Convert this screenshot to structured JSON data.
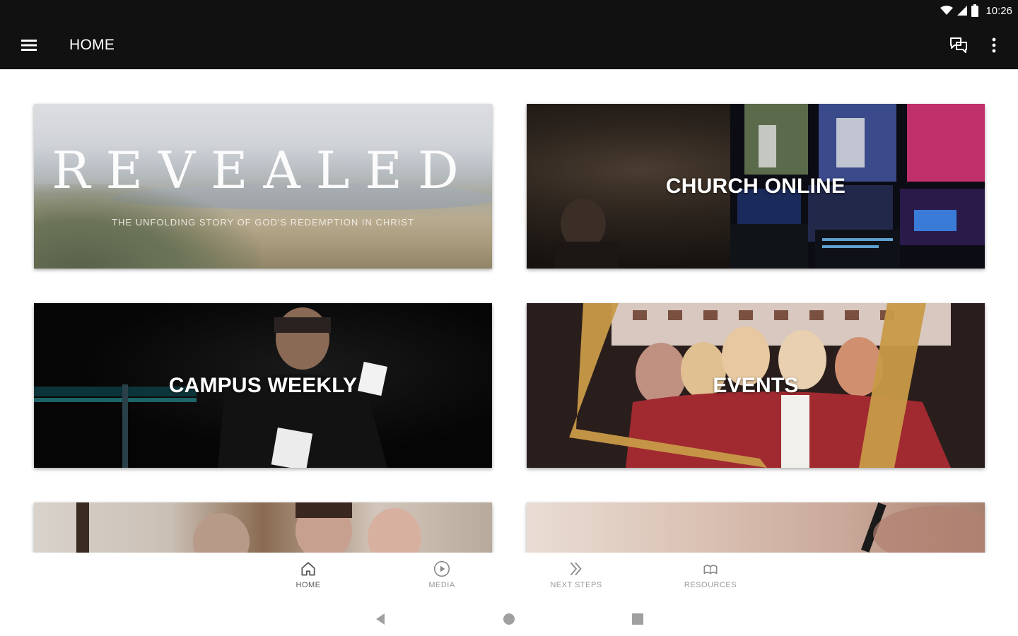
{
  "status_bar": {
    "time": "10:26"
  },
  "app_bar": {
    "title": "HOME",
    "menu_icon": "hamburger-menu-icon",
    "chat_icon": "chat-bubbles-icon",
    "more_icon": "more-vert-icon"
  },
  "cards": [
    {
      "id": "revealed",
      "title": "REVEALED",
      "subtitle": "THE UNFOLDING STORY OF GOD'S REDEMPTION IN CHRIST"
    },
    {
      "id": "church-online",
      "title": "CHURCH ONLINE"
    },
    {
      "id": "campus-weekly",
      "title": "CAMPUS WEEKLY"
    },
    {
      "id": "events",
      "title": "EVENTS"
    },
    {
      "id": "row3-left",
      "title": ""
    },
    {
      "id": "row3-right",
      "title": ""
    }
  ],
  "bottom_nav": {
    "items": [
      {
        "label": "HOME",
        "icon": "home-icon",
        "active": true
      },
      {
        "label": "MEDIA",
        "icon": "play-circle-icon",
        "active": false
      },
      {
        "label": "NEXT STEPS",
        "icon": "double-chevron-right-icon",
        "active": false
      },
      {
        "label": "RESOURCES",
        "icon": "book-open-icon",
        "active": false
      }
    ]
  },
  "system_nav": {
    "back": "back-icon",
    "home": "home-circle-icon",
    "recents": "recents-square-icon"
  },
  "colors": {
    "app_bar": "#111111",
    "background": "#ffffff",
    "nav_label": "#9a9a9a"
  }
}
